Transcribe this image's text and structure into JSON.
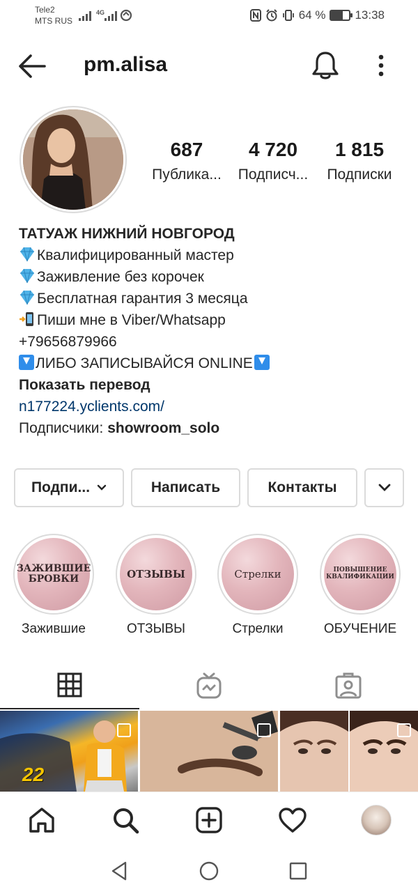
{
  "status_bar": {
    "carrier_1": "Tele2",
    "carrier_2": "MTS RUS",
    "network": "4G",
    "battery": "64 %",
    "battery_level": 0.64,
    "time": "13:38"
  },
  "header": {
    "username": "pm.alisa"
  },
  "stats": [
    {
      "value": "687",
      "label": "Публика..."
    },
    {
      "value": "4 720",
      "label": "Подписч..."
    },
    {
      "value": "1 815",
      "label": "Подписки"
    }
  ],
  "bio": {
    "name": "ТАТУАЖ НИЖНИЙ НОВГОРОД",
    "line1": "Квалифицированный мастер",
    "line2": "Заживление без корочек",
    "line3": "Бесплатная гарантия 3 месяца",
    "line4": "Пиши мне в Viber/Whatsapp",
    "phone": "+79656879966",
    "line6": "ЛИБО ЗАПИСЫВАЙСЯ ONLINE",
    "translate": "Показать перевод",
    "link": "n177224.yclients.com/",
    "followed_by_prefix": "Подписчики: ",
    "followed_by_user": "showroom_solo"
  },
  "actions": {
    "following": "Подпи...",
    "message": "Написать",
    "contacts": "Контакты"
  },
  "highlights": [
    {
      "cover_text": "ЗАЖИВШИЕ БРОВКИ",
      "label": "Зажившие"
    },
    {
      "cover_text": "ОТЗЫВЫ",
      "label": "ОТЗЫВЫ"
    },
    {
      "cover_text": "Стрелки",
      "label": "Стрелки"
    },
    {
      "cover_text": "ПОВЫШЕНИЕ КВАЛИФИКАЦИИ",
      "label": "ОБУЧЕНИЕ"
    }
  ],
  "photo_badges": {
    "cell1_number": "22"
  },
  "icons": {
    "back": "arrow-left-icon",
    "bell": "bell-icon",
    "more": "more-vertical-icon",
    "grid": "grid-icon",
    "igtv": "igtv-icon",
    "tagged": "tagged-icon",
    "home": "home-icon",
    "search": "search-icon",
    "add": "add-icon",
    "activity": "heart-icon"
  },
  "colors": {
    "link": "#00376b",
    "gem": "#4fb3e8",
    "highlight_pink": "#e3b6bc",
    "border": "#dbdbdb"
  }
}
